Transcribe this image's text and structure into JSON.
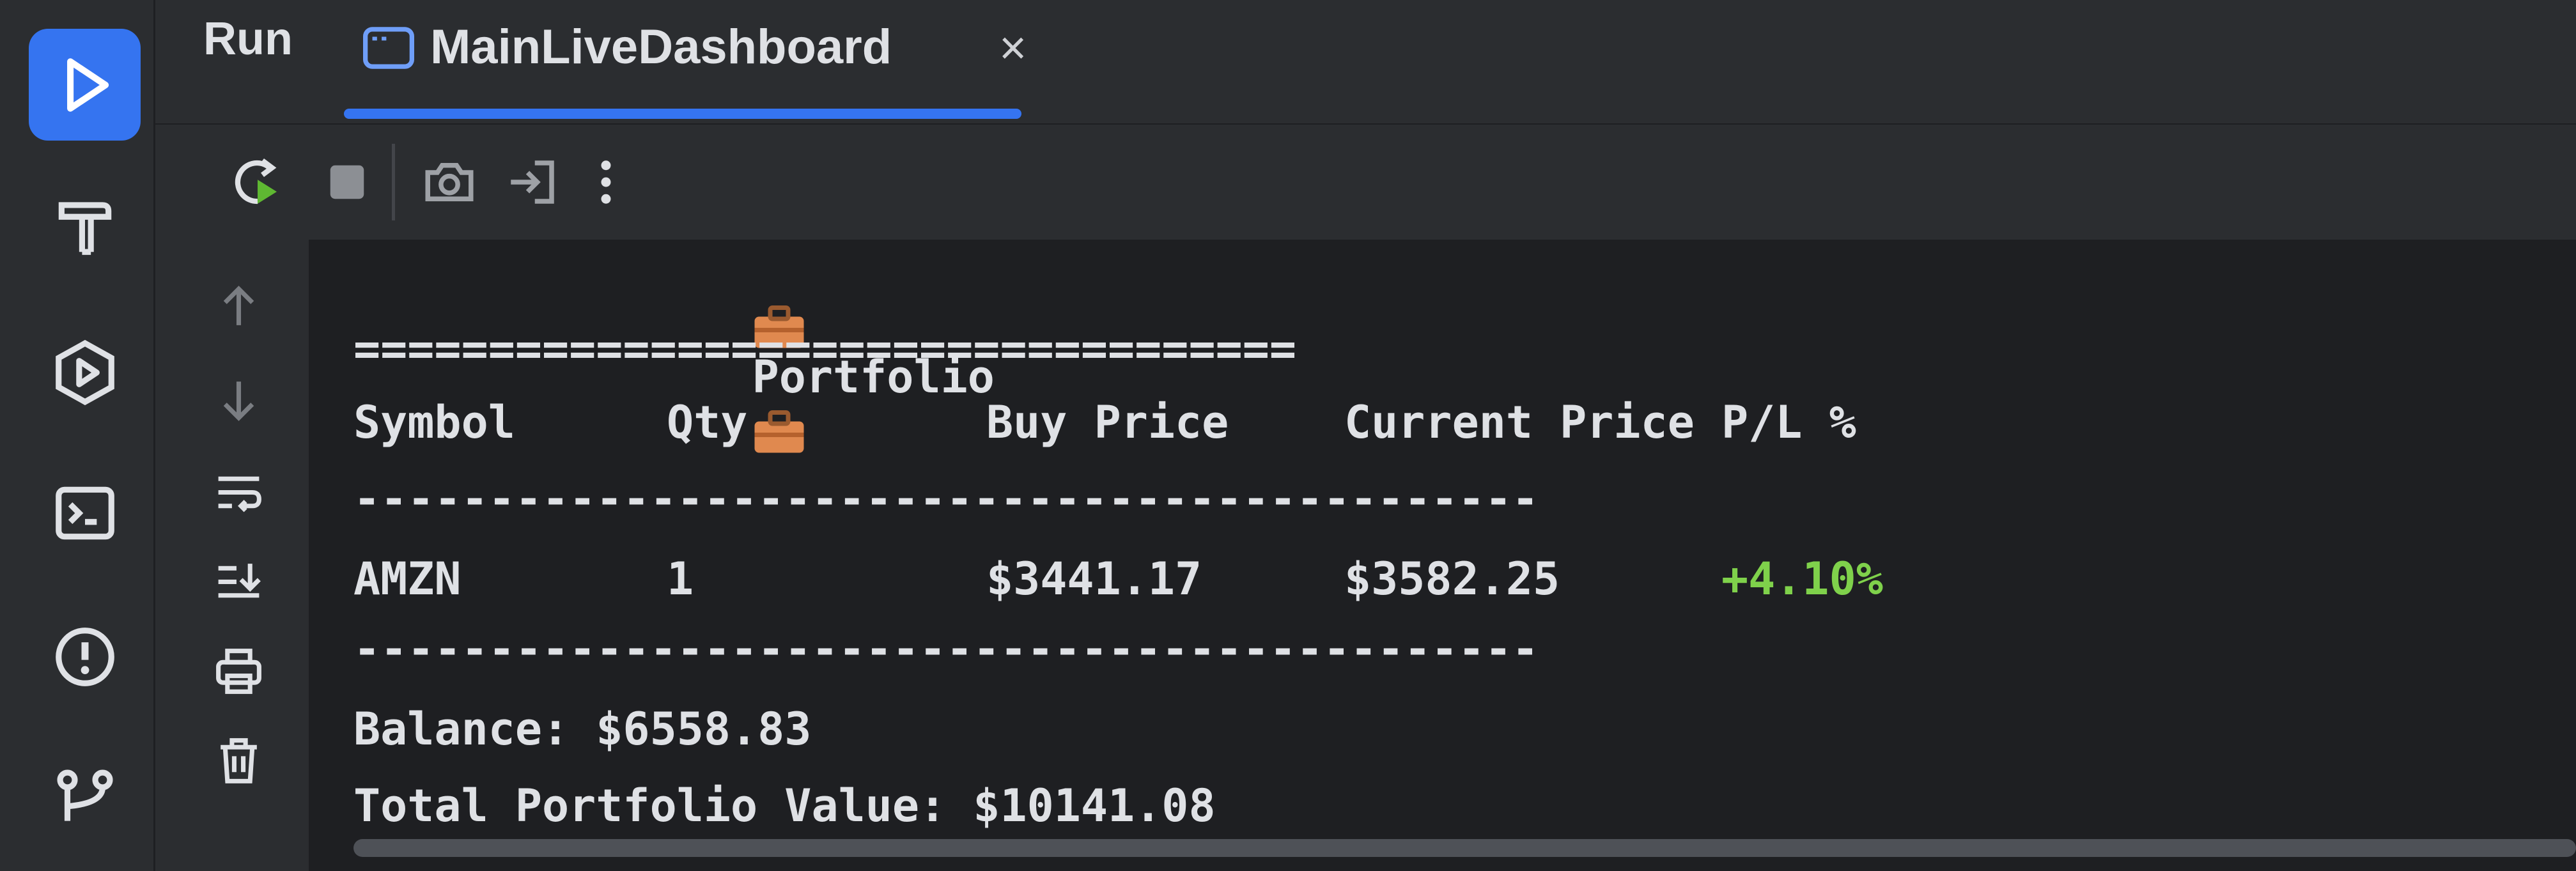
{
  "header": {
    "run_label": "Run",
    "tab_label": "MainLiveDashboard",
    "tab_close": "×"
  },
  "stripe_icons": [
    "run-icon",
    "build-hammer-icon",
    "services-icon",
    "terminal-icon",
    "problems-icon",
    "git-icon"
  ],
  "toolbar_icons": [
    "rerun-icon",
    "stop-icon",
    "screenshot-icon",
    "exit-icon",
    "more-icon"
  ],
  "side_icons": [
    "scroll-up-icon",
    "scroll-down-icon",
    "soft-wrap-icon",
    "scroll-to-end-icon",
    "print-icon",
    "clear-icon"
  ],
  "console": {
    "title": "Portfolio",
    "double_rule": "===================================",
    "headers": {
      "symbol": "Symbol",
      "qty": "Qty",
      "buy_price": "Buy Price",
      "current_price": "Current Price",
      "pl": "P/L %"
    },
    "single_rule": "--------------------------------------------",
    "rows": [
      {
        "symbol": "AMZN",
        "qty": "1",
        "buy_price": "$3441.17",
        "current_price": "$3582.25",
        "pl": "+4.10%"
      }
    ],
    "balance": "Balance: $6558.83",
    "total_value": "Total Portfolio Value: $10141.08"
  },
  "colors": {
    "accent": "#3574f0",
    "positive": "#7fd14b",
    "console_bg": "#1e1f22",
    "panel_bg": "#2b2d30"
  }
}
